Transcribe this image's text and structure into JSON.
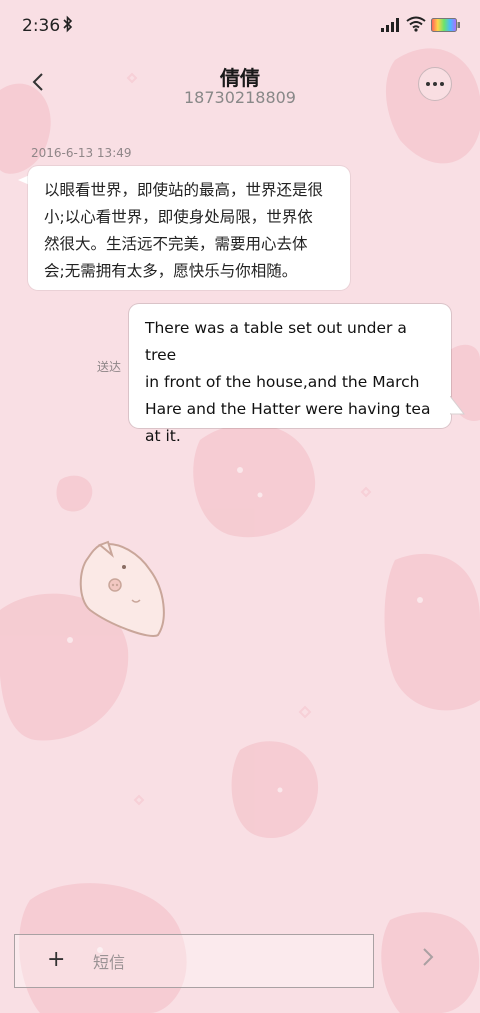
{
  "status_bar": {
    "time": "2:36"
  },
  "header": {
    "contact_name": "倩倩",
    "phone_number": "18730218809"
  },
  "conversation": {
    "timestamp": "2016-6-13 13:49",
    "incoming_message": {
      "lines": [
        "以眼看世界，即使站的最高，世界还是很",
        "小;以心看世界，即使身处局限，世界依",
        "然很大。生活远不完美，需要用心去体",
        "会;无需拥有太多，愿快乐与你相随。"
      ]
    },
    "outgoing_message": {
      "lines": [
        "There was a table set out under a tree",
        "in front of the house,and the March",
        "Hare and the Hatter were having tea",
        "at it."
      ],
      "status": "送达"
    }
  },
  "composer": {
    "placeholder": "短信"
  },
  "colors": {
    "background": "#f9dfe4",
    "strawberry": "#f3b8c2",
    "bubble": "#ffffff"
  }
}
